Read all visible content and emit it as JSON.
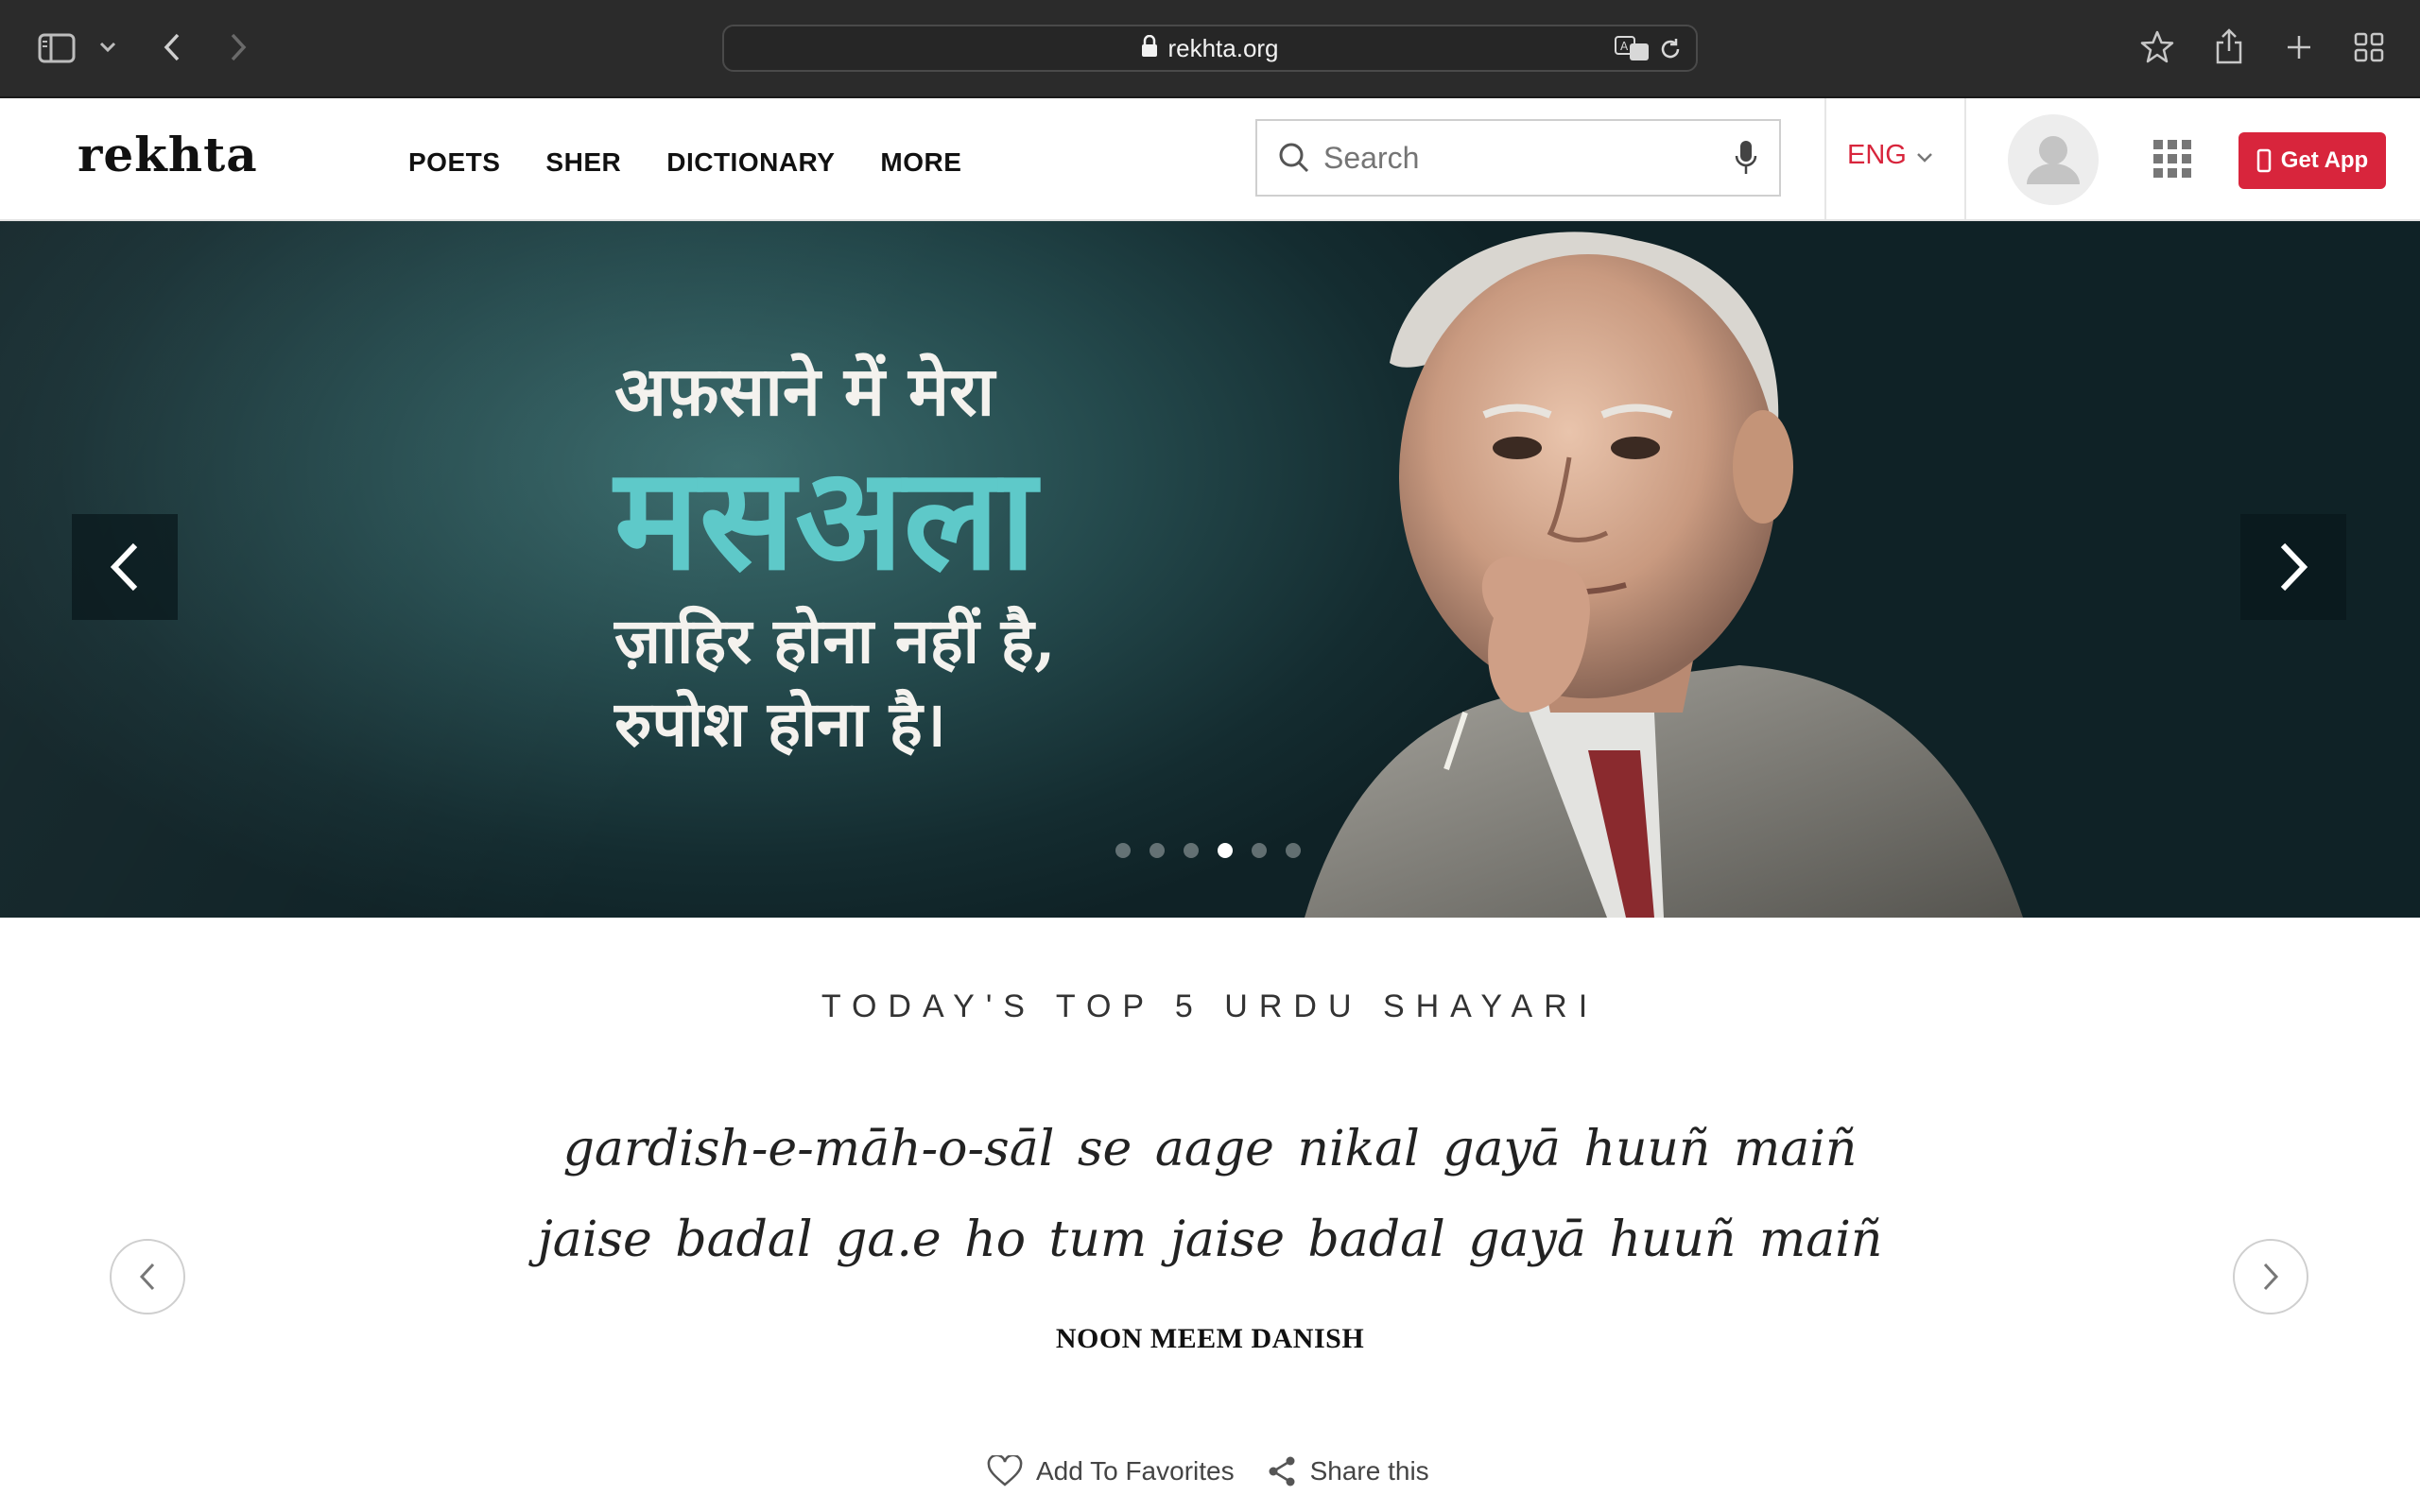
{
  "browser": {
    "url": "rekhta.org",
    "icons": [
      "sidebar-icon",
      "chevron-down-icon",
      "back-icon",
      "forward-icon",
      "lock-icon",
      "translate-icon",
      "reload-icon",
      "star-icon",
      "share-icon",
      "plus-icon",
      "tab-grid-icon"
    ]
  },
  "header": {
    "logo": "rekhta",
    "nav": [
      "POETS",
      "SHER",
      "DICTIONARY",
      "MORE"
    ],
    "search_placeholder": "Search",
    "language": "ENG",
    "get_app": "Get App",
    "accent_color": "#d8253c"
  },
  "hero": {
    "line1": "अफ़साने में मेरा",
    "line2": "मसअला",
    "line3": "ज़ाहिर होना नहीं है,",
    "line4": "रुपोश होना है।",
    "slide_count": 6,
    "active_slide": 4
  },
  "shayari": {
    "section_title": "TODAY'S TOP 5 URDU SHAYARI",
    "line1": "gardish-e-māh-o-sāl se aage nikal gayā huuñ maiñ",
    "line2": "jaise badal ga.e ho tum jaise badal gayā huuñ maiñ",
    "poet": "NOON MEEM DANISH",
    "add_favorites": "Add To Favorites",
    "share": "Share this"
  }
}
